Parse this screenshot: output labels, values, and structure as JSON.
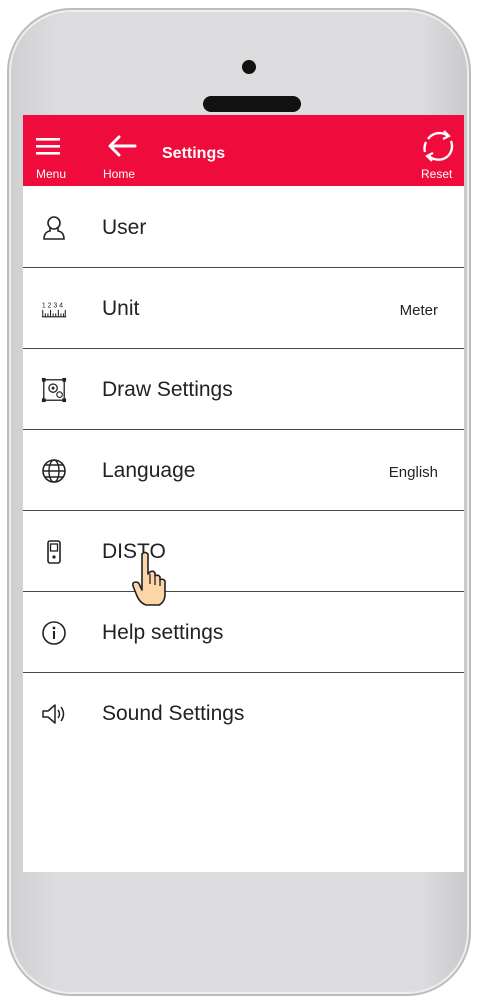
{
  "header": {
    "title": "Settings",
    "menu_label": "Menu",
    "home_label": "Home",
    "reset_label": "Reset",
    "bg_color": "#ef0c3c"
  },
  "settings": {
    "items": [
      {
        "label": "User",
        "value": "",
        "icon": "user-icon"
      },
      {
        "label": "Unit",
        "value": "Meter",
        "icon": "ruler-icon"
      },
      {
        "label": "Draw Settings",
        "value": "",
        "icon": "draw-settings-icon"
      },
      {
        "label": "Language",
        "value": "English",
        "icon": "globe-icon"
      },
      {
        "label": "DISTO",
        "value": "",
        "icon": "disto-device-icon"
      },
      {
        "label": "Help settings",
        "value": "",
        "icon": "info-icon"
      },
      {
        "label": "Sound Settings",
        "value": "",
        "icon": "speaker-icon"
      }
    ]
  },
  "unit_icon_digits": "1 2 3 4",
  "pointer": {
    "icon": "hand-pointer-icon"
  }
}
